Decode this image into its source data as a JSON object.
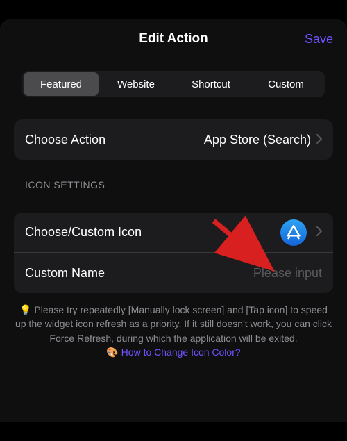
{
  "header": {
    "title": "Edit Action",
    "save_label": "Save"
  },
  "tabs": [
    {
      "label": "Featured",
      "selected": true
    },
    {
      "label": "Website",
      "selected": false
    },
    {
      "label": "Shortcut",
      "selected": false
    },
    {
      "label": "Custom",
      "selected": false
    }
  ],
  "action_row": {
    "label": "Choose Action",
    "value": "App Store (Search)"
  },
  "icon_section": {
    "header": "ICON SETTINGS",
    "choose_icon_label": "Choose/Custom Icon",
    "custom_name_label": "Custom Name",
    "custom_name_placeholder": "Please input",
    "custom_name_value": ""
  },
  "hint": {
    "bulb": "💡",
    "text": " Please try repeatedly [Manually lock screen] and [Tap icon] to speed up the widget icon refresh as a priority. If it still doesn't work, you can click Force Refresh, during which the application will be exited.",
    "palette": "🎨",
    "link_text": " How to Change Icon Color?"
  }
}
